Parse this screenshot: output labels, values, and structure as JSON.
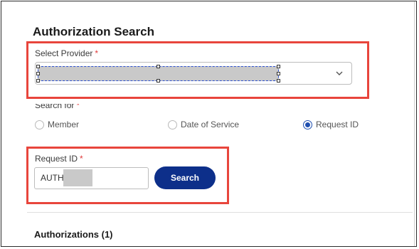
{
  "page": {
    "title": "Authorization Search"
  },
  "provider": {
    "label": "Select Provider",
    "required_mark": "*",
    "selected_value": "",
    "value_redacted": true,
    "dropdown_icon": "chevron-down-icon"
  },
  "search_for": {
    "label": "Search for",
    "required_mark": "*",
    "options": [
      {
        "label": "Member",
        "checked": false
      },
      {
        "label": "Date of Service",
        "checked": false
      },
      {
        "label": "Request ID",
        "checked": true
      }
    ]
  },
  "request_id": {
    "label": "Request ID",
    "required_mark": "*",
    "value_prefix": "AUTH-",
    "value_redacted": true
  },
  "search_button": {
    "label": "Search"
  },
  "authorizations": {
    "heading": "Authorizations",
    "count": "(1)"
  },
  "colors": {
    "accent": "#0d2f8a",
    "required": "#e03b3b",
    "highlight": "#e8453c",
    "redaction": "#c9c9c9"
  }
}
